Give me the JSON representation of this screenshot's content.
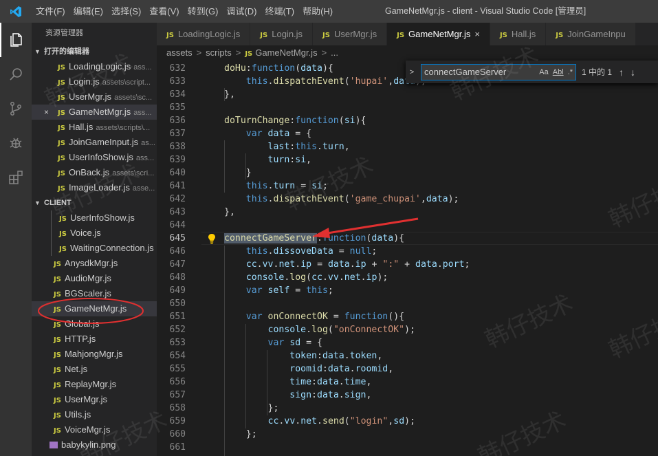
{
  "title_bar": {
    "menu": [
      "文件(F)",
      "编辑(E)",
      "选择(S)",
      "查看(V)",
      "转到(G)",
      "调试(D)",
      "终端(T)",
      "帮助(H)"
    ],
    "window_title": "GameNetMgr.js - client - Visual Studio Code [管理员]"
  },
  "sidebar": {
    "title": "资源管理器",
    "open_editors_header": "打开的编辑器",
    "open_editors": [
      {
        "name": "LoadingLogic.js",
        "path": "ass..."
      },
      {
        "name": "Login.js",
        "path": "assets\\script..."
      },
      {
        "name": "UserMgr.js",
        "path": "assets\\sc..."
      },
      {
        "name": "GameNetMgr.js",
        "path": "ass..."
      },
      {
        "name": "Hall.js",
        "path": "assets\\scripts\\..."
      },
      {
        "name": "JoinGameInput.js",
        "path": "as..."
      },
      {
        "name": "UserInfoShow.js",
        "path": "ass..."
      },
      {
        "name": "OnBack.js",
        "path": "assets\\scri..."
      },
      {
        "name": "ImageLoader.js",
        "path": "asse..."
      }
    ],
    "client_header": "CLIENT",
    "client_sub_files": [
      "UserInfoShow.js",
      "Voice.js",
      "WaitingConnection.js"
    ],
    "client_files": [
      "AnysdkMgr.js",
      "AudioMgr.js",
      "BGScaler.js",
      "GameNetMgr.js",
      "Global.js",
      "HTTP.js",
      "MahjongMgr.js",
      "Net.js",
      "ReplayMgr.js",
      "UserMgr.js",
      "Utils.js",
      "VoiceMgr.js"
    ],
    "png_file": "babykylin.png"
  },
  "tabs": [
    "LoadingLogic.js",
    "Login.js",
    "UserMgr.js",
    "GameNetMgr.js",
    "Hall.js",
    "JoinGameInpu"
  ],
  "active_tab": "GameNetMgr.js",
  "breadcrumb": [
    "assets",
    "scripts",
    "GameNetMgr.js",
    "..."
  ],
  "find": {
    "query": "connectGameServer",
    "case_label": "Aa",
    "word_label": "Abl",
    "regex_label": ".*",
    "count": "1 中的 1"
  },
  "editor": {
    "line_numbers": [
      "632",
      "633",
      "634",
      "635",
      "636",
      "637",
      "638",
      "639",
      "640",
      "641",
      "642",
      "643",
      "644",
      "645",
      "646",
      "647",
      "648",
      "649",
      "650",
      "651",
      "652",
      "653",
      "654",
      "655",
      "656",
      "657",
      "658",
      "659",
      "660",
      "661"
    ],
    "current_line": "645"
  },
  "watermark": "韩仔技术",
  "colors": {
    "keyword": "#569cd6",
    "property": "#9cdcfe",
    "function": "#dcdcaa",
    "string": "#ce9178",
    "annotation_red": "#e03030"
  }
}
